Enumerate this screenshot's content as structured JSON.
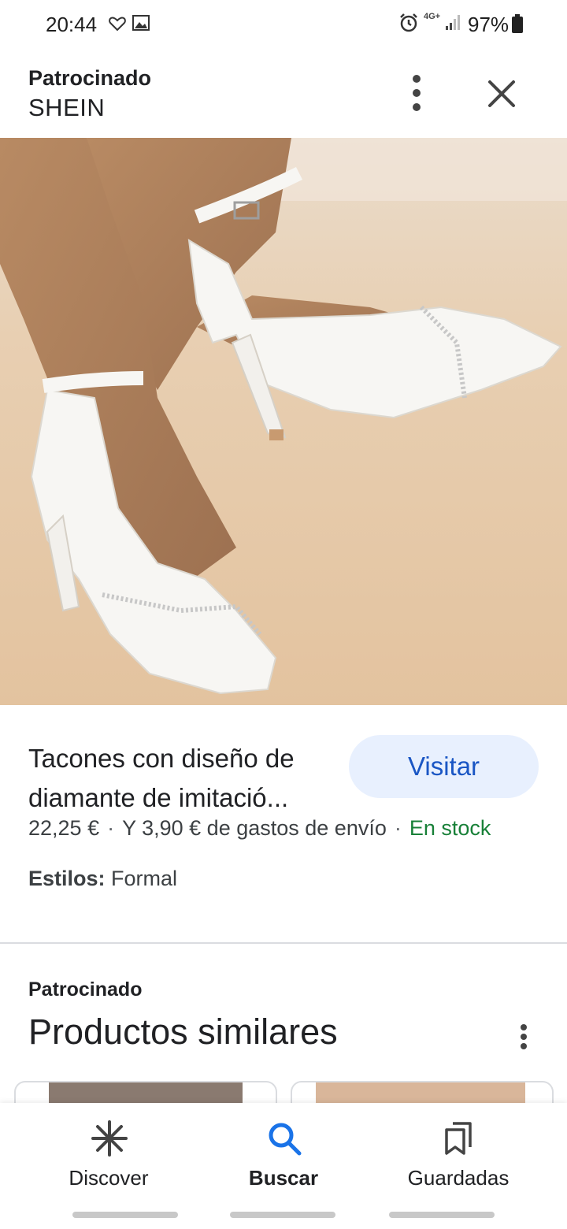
{
  "status_bar": {
    "time": "20:44",
    "network": "4G+",
    "battery": "97%"
  },
  "ad": {
    "sponsored_label": "Patrocinado",
    "brand": "SHEIN"
  },
  "product": {
    "title_line1": "Tacones con diseño de",
    "title_line2": "diamante de imitació...",
    "visit_label": "Visitar",
    "price": "22,25 €",
    "separator": "·",
    "shipping": "Y 3,90 € de gastos de envío",
    "stock": "En stock",
    "styles_label": "Estilos:",
    "styles_value": "Formal"
  },
  "similar": {
    "sponsored_label": "Patrocinado",
    "title": "Productos similares"
  },
  "bottom_nav": {
    "items": [
      {
        "label": "Discover",
        "icon": "asterisk-icon"
      },
      {
        "label": "Buscar",
        "icon": "search-icon",
        "active": true
      },
      {
        "label": "Guardadas",
        "icon": "bookmarks-icon"
      }
    ]
  },
  "colors": {
    "accent_blue": "#1a73e8",
    "visit_bg": "#e8f0fe",
    "stock_green": "#188038"
  }
}
